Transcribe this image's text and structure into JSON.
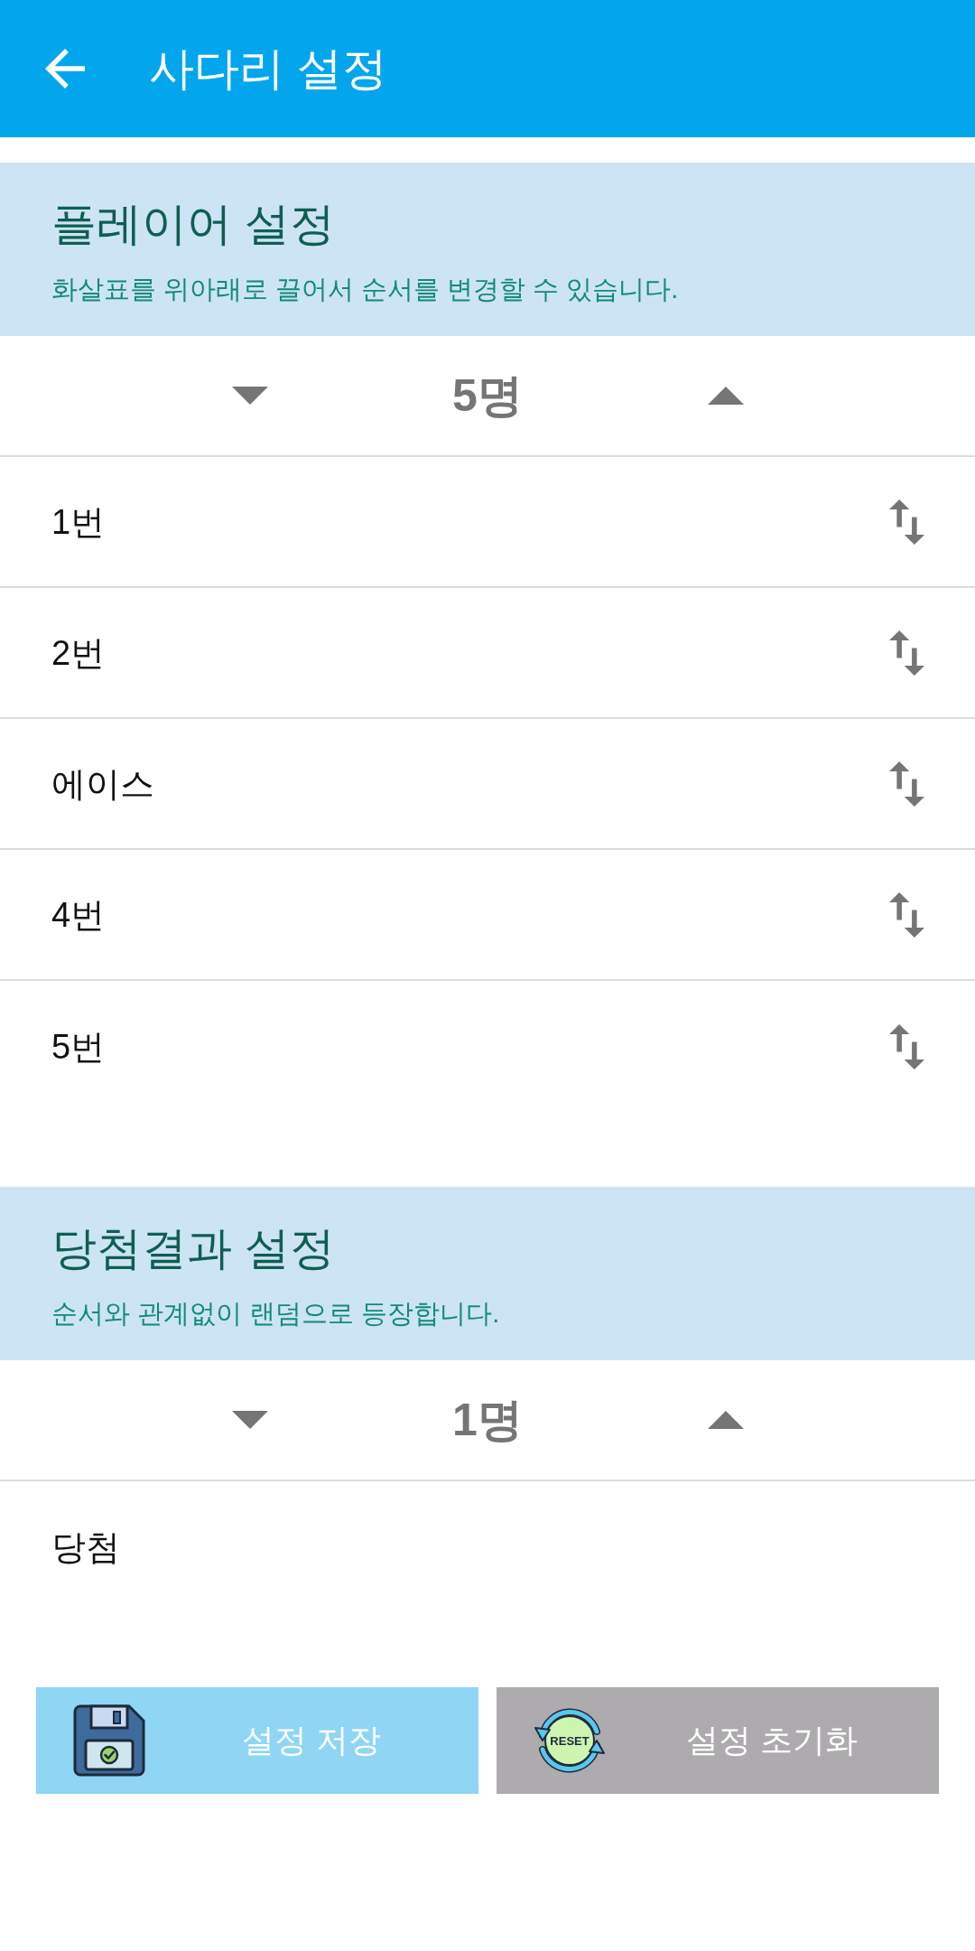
{
  "app_bar": {
    "title": "사다리 설정"
  },
  "sections": [
    {
      "title": "플레이어 설정",
      "subtitle": "화살표를 위아래로 끌어서 순서를 변경할 수 있습니다.",
      "count": "5명",
      "items": [
        {
          "label": "1번",
          "kind": "reorderable"
        },
        {
          "label": "2번",
          "kind": "reorderable"
        },
        {
          "label": "에이스",
          "kind": "reorderable"
        },
        {
          "label": "4번",
          "kind": "reorderable"
        },
        {
          "label": "5번",
          "kind": "reorderable"
        }
      ]
    },
    {
      "title": "당첨결과 설정",
      "subtitle": "순서와 관계없이 랜덤으로 등장합니다.",
      "count": "1명",
      "items": [
        {
          "label": "당첨",
          "kind": "plain"
        }
      ]
    }
  ],
  "buttons": [
    {
      "label": "설정 저장",
      "kind": "save"
    },
    {
      "label": "설정 초기화",
      "kind": "reset",
      "icon_text": "RESET"
    }
  ]
}
